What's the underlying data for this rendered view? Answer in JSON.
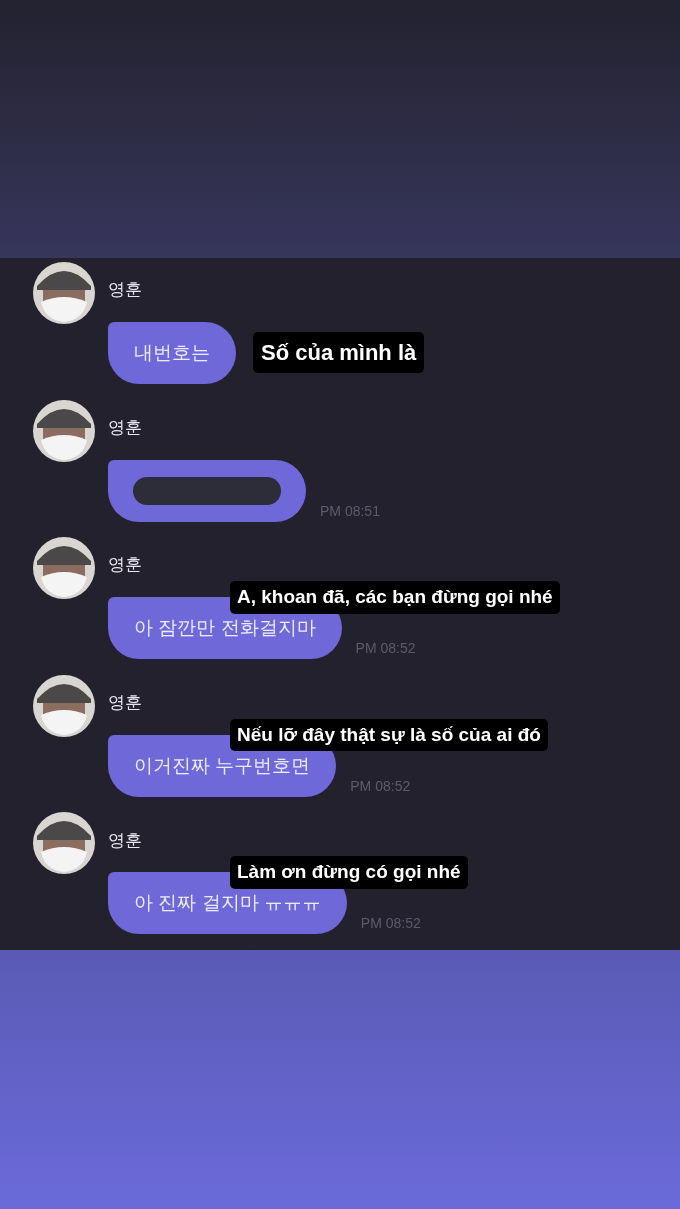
{
  "messages": [
    {
      "sender": "영훈",
      "kind": "text",
      "text": "내번호는",
      "caption": {
        "text": "Số của mình là",
        "kind": "beside"
      }
    },
    {
      "sender": "영훈",
      "kind": "redacted",
      "time": "PM 08:51"
    },
    {
      "sender": "영훈",
      "kind": "text",
      "text": "아 잠깐만 전화걸지마",
      "time": "PM 08:52",
      "caption": {
        "text": "A, khoan đã, các bạn đừng gọi nhé",
        "kind": "over"
      }
    },
    {
      "sender": "영훈",
      "kind": "text",
      "text": "이거진짜 누구번호면",
      "time": "PM 08:52",
      "caption": {
        "text": "Nếu lỡ đây thật sự là số của ai đó",
        "kind": "over"
      }
    },
    {
      "sender": "영훈",
      "kind": "text",
      "text": "아 진짜 걸지마 ㅠㅠㅠ",
      "time": "PM 08:52",
      "caption": {
        "text": "Làm ơn đừng có gọi nhé",
        "kind": "over"
      }
    }
  ]
}
